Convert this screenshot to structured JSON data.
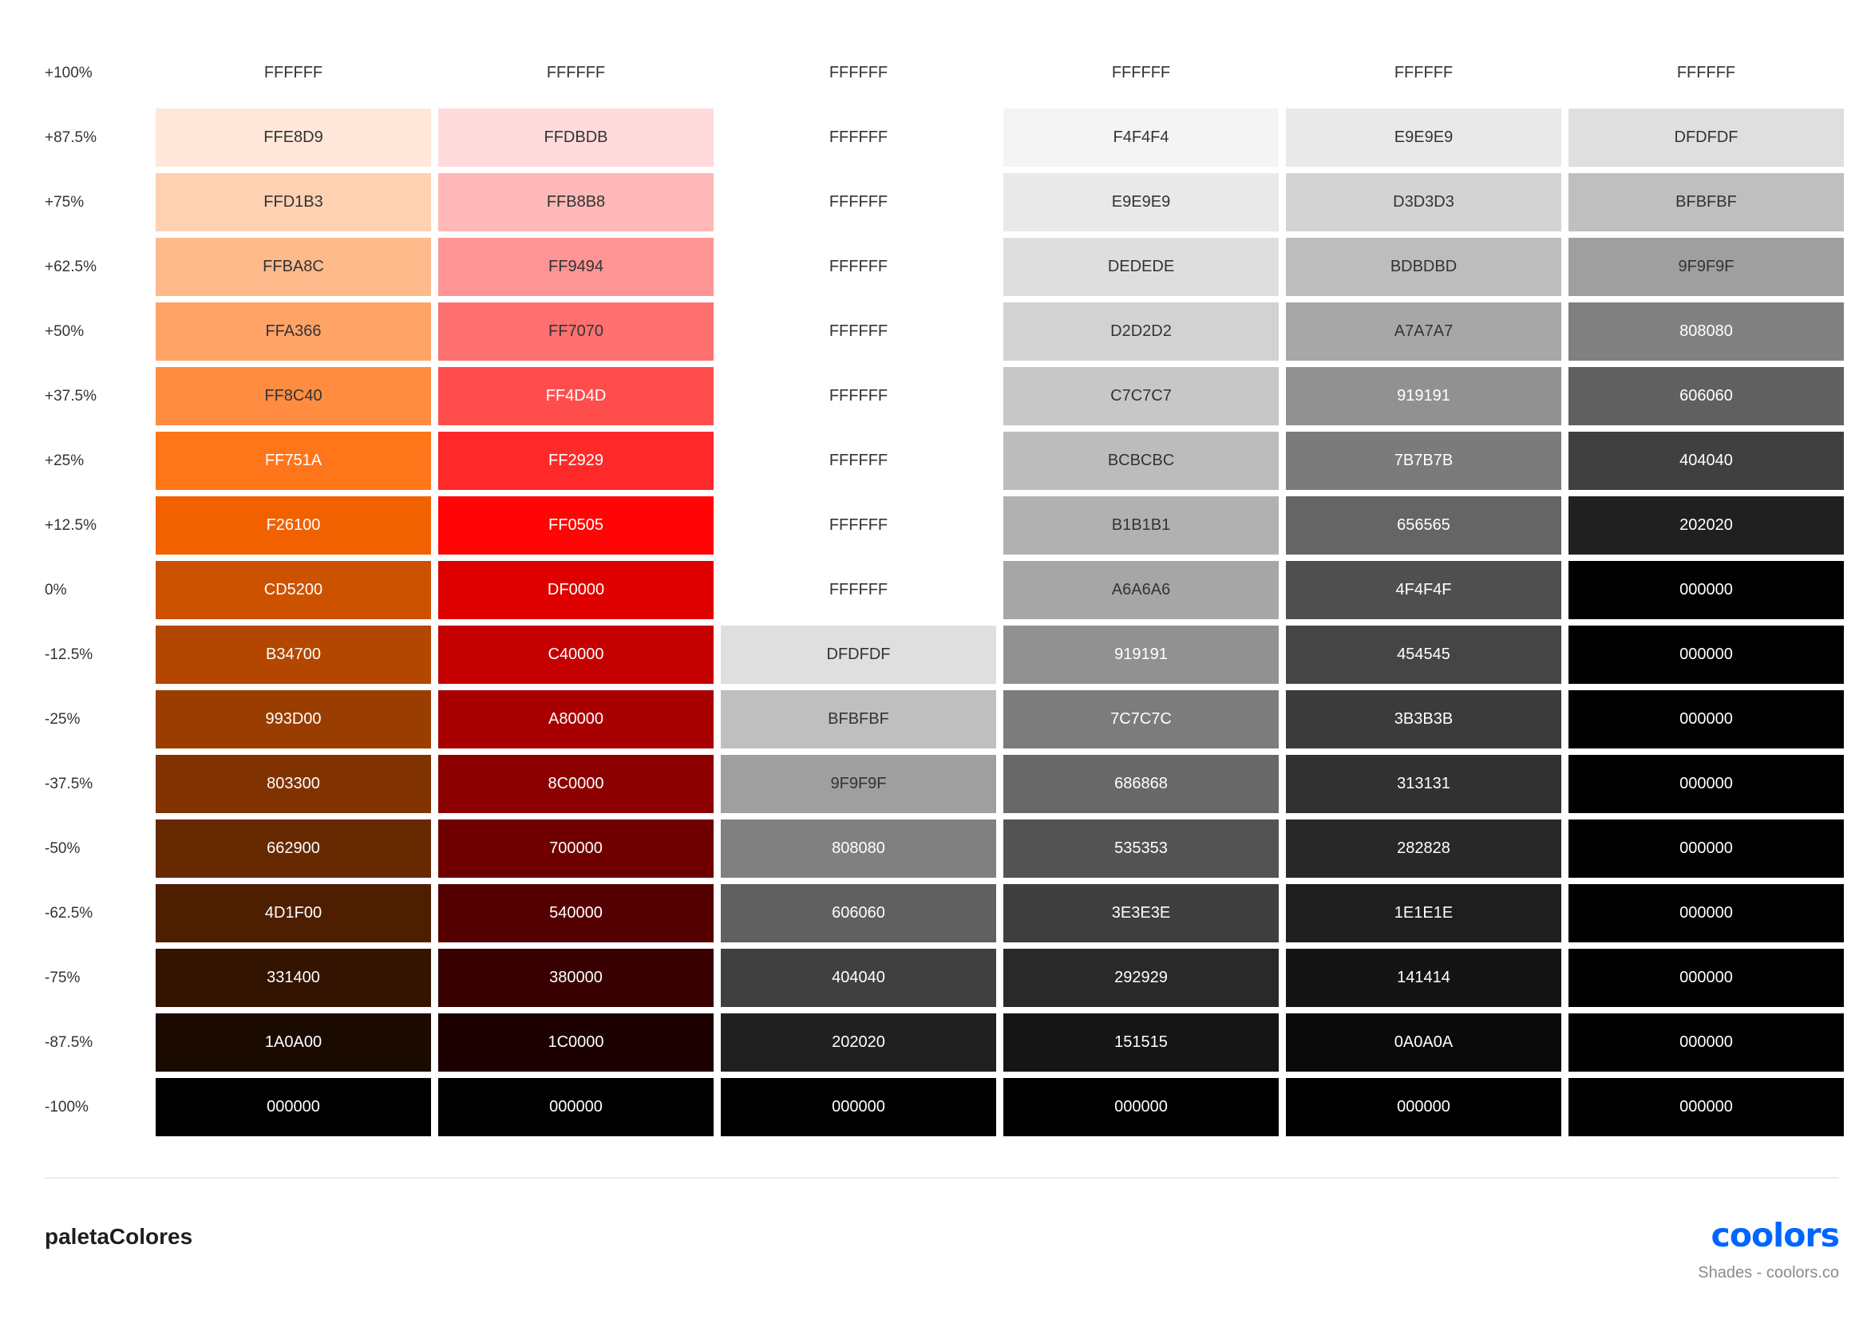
{
  "palette_name": "paletaColores",
  "brand": "coolors",
  "footer_subtitle": "Shades - coolors.co",
  "row_labels": [
    "+100%",
    "+87.5%",
    "+75%",
    "+62.5%",
    "+50%",
    "+37.5%",
    "+25%",
    "+12.5%",
    "0%",
    "-12.5%",
    "-25%",
    "-37.5%",
    "-50%",
    "-62.5%",
    "-75%",
    "-87.5%",
    "-100%"
  ],
  "columns": [
    [
      "FFFFFF",
      "FFE8D9",
      "FFD1B3",
      "FFBA8C",
      "FFA366",
      "FF8C40",
      "FF751A",
      "F26100",
      "CD5200",
      "B34700",
      "993D00",
      "803300",
      "662900",
      "4D1F00",
      "331400",
      "1A0A00",
      "000000"
    ],
    [
      "FFFFFF",
      "FFDBDB",
      "FFB8B8",
      "FF9494",
      "FF7070",
      "FF4D4D",
      "FF2929",
      "FF0505",
      "DF0000",
      "C40000",
      "A80000",
      "8C0000",
      "700000",
      "540000",
      "380000",
      "1C0000",
      "000000"
    ],
    [
      "FFFFFF",
      "FFFFFF",
      "FFFFFF",
      "FFFFFF",
      "FFFFFF",
      "FFFFFF",
      "FFFFFF",
      "FFFFFF",
      "FFFFFF",
      "DFDFDF",
      "BFBFBF",
      "9F9F9F",
      "808080",
      "606060",
      "404040",
      "202020",
      "000000"
    ],
    [
      "FFFFFF",
      "F4F4F4",
      "E9E9E9",
      "DEDEDE",
      "D2D2D2",
      "C7C7C7",
      "BCBCBC",
      "B1B1B1",
      "A6A6A6",
      "919191",
      "7C7C7C",
      "686868",
      "535353",
      "3E3E3E",
      "292929",
      "151515",
      "000000"
    ],
    [
      "FFFFFF",
      "E9E9E9",
      "D3D3D3",
      "BDBDBD",
      "A7A7A7",
      "919191",
      "7B7B7B",
      "656565",
      "4F4F4F",
      "454545",
      "3B3B3B",
      "313131",
      "282828",
      "1E1E1E",
      "141414",
      "0A0A0A",
      "000000"
    ],
    [
      "FFFFFF",
      "DFDFDF",
      "BFBFBF",
      "9F9F9F",
      "808080",
      "606060",
      "404040",
      "202020",
      "000000",
      "000000",
      "000000",
      "000000",
      "000000",
      "000000",
      "000000",
      "000000",
      "000000"
    ]
  ]
}
